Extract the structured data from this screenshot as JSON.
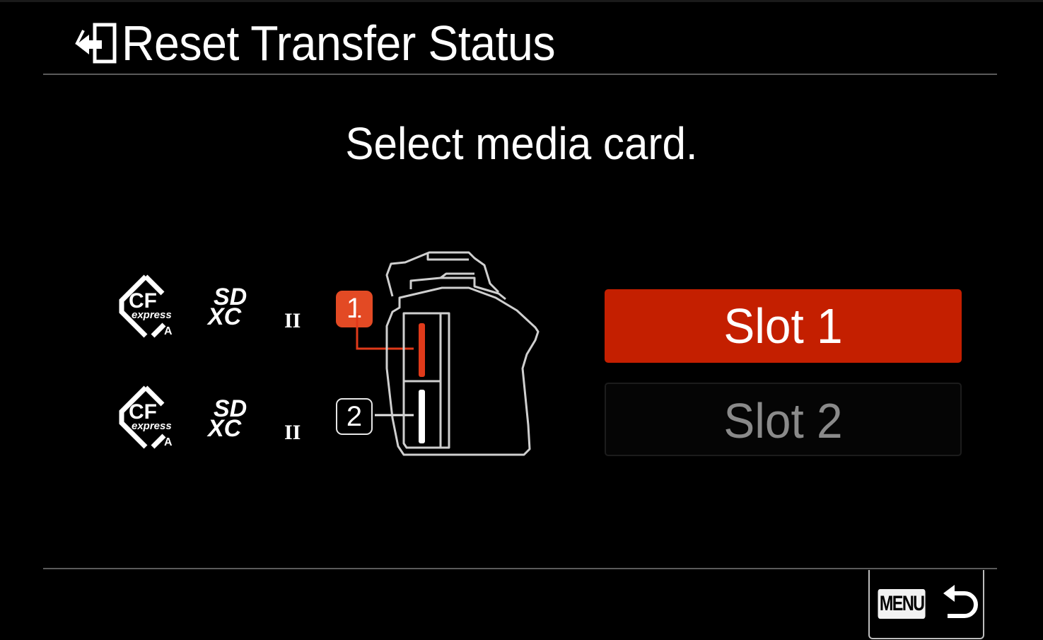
{
  "header": {
    "title": "Reset Transfer Status",
    "icon": "transfer-icon"
  },
  "prompt": "Select media card.",
  "media": {
    "cf_logo_main": "CF",
    "cf_logo_sub": "express",
    "cf_logo_type": "A",
    "sd_logo_main": "SD",
    "sd_logo_sub": "XC",
    "sd_logo_bus": "II"
  },
  "slots": [
    {
      "marker": "1",
      "label": "Slot 1",
      "selected": true
    },
    {
      "marker": "2",
      "label": "Slot 2",
      "selected": false
    }
  ],
  "back": {
    "menu_label": "MENU",
    "icon": "return-arrow-icon"
  },
  "colors": {
    "accent": "#c41f00",
    "marker_accent": "#e34a24",
    "card_slot_active": "#e03a1a",
    "background": "#000000",
    "text": "#ffffff",
    "text_dim": "#8a8a8a"
  }
}
